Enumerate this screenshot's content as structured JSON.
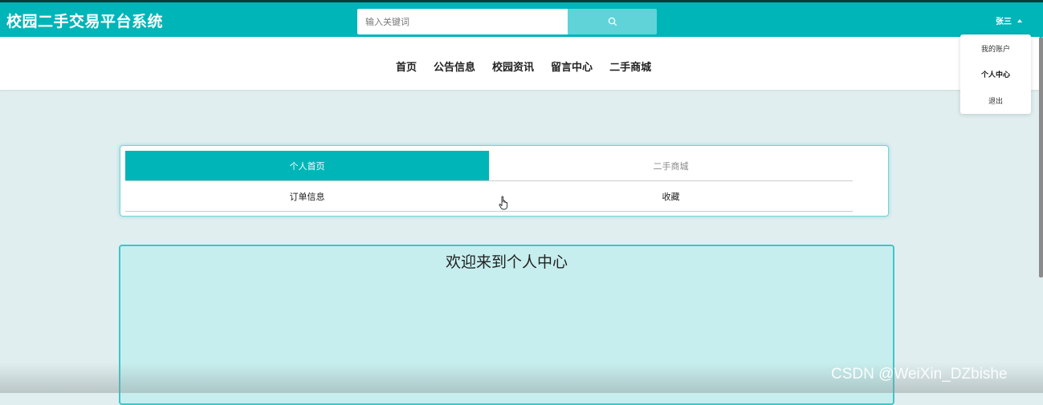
{
  "header": {
    "site_title": "校园二手交易平台系统",
    "search": {
      "placeholder": "输入关键词",
      "value": ""
    },
    "search_button_icon": "search-icon",
    "user": {
      "name": "张三",
      "dropdown_icon": "caret-up-icon"
    }
  },
  "nav": {
    "items": [
      {
        "label": "首页"
      },
      {
        "label": "公告信息"
      },
      {
        "label": "校园资讯"
      },
      {
        "label": "留言中心"
      },
      {
        "label": "二手商城"
      }
    ]
  },
  "user_dropdown": {
    "items": [
      {
        "label": "我的账户",
        "active": false
      },
      {
        "label": "个人中心",
        "active": true
      },
      {
        "label": "退出",
        "active": false
      }
    ]
  },
  "center_menu": {
    "items": [
      {
        "label": "个人首页",
        "active": true
      },
      {
        "label": "二手商城",
        "active": false
      },
      {
        "label": "订单信息",
        "active": false
      },
      {
        "label": "收藏",
        "active": false
      }
    ]
  },
  "welcome": {
    "title": "欢迎来到个人中心"
  },
  "watermark": "CSDN @WeiXin_DZbishe",
  "colors": {
    "brand": "#00b5b8",
    "search_button": "#60d3d8",
    "page_bg": "#e0eeef",
    "panel_bg": "#c7eeee"
  }
}
